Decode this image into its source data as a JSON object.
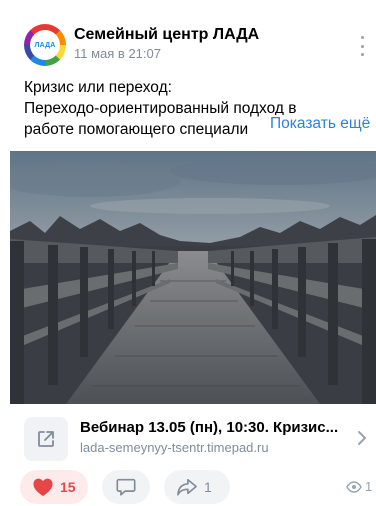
{
  "post": {
    "author": "Семейный центр ЛАДА",
    "avatar_text": "ЛАДА",
    "date": "11 мая в 21:07",
    "text_lines": [
      "Кризис или переход:",
      "Переходо-ориентированный подход в",
      "работе помогающего специали"
    ],
    "show_more": "Показать ещё",
    "photo_icon": "wooden-boardwalk-photo"
  },
  "link": {
    "title": "Вебинар 13.05 (пн), 10:30. Кризис...",
    "url": "lada-semeynyy-tsentr.timepad.ru",
    "icon": "external-link-icon"
  },
  "actions": {
    "likes": "15",
    "comments": "",
    "shares": "1",
    "views": "1"
  },
  "colors": {
    "accent": "#2d81e0",
    "like": "#e64646",
    "secondary_text": "#818c99"
  }
}
